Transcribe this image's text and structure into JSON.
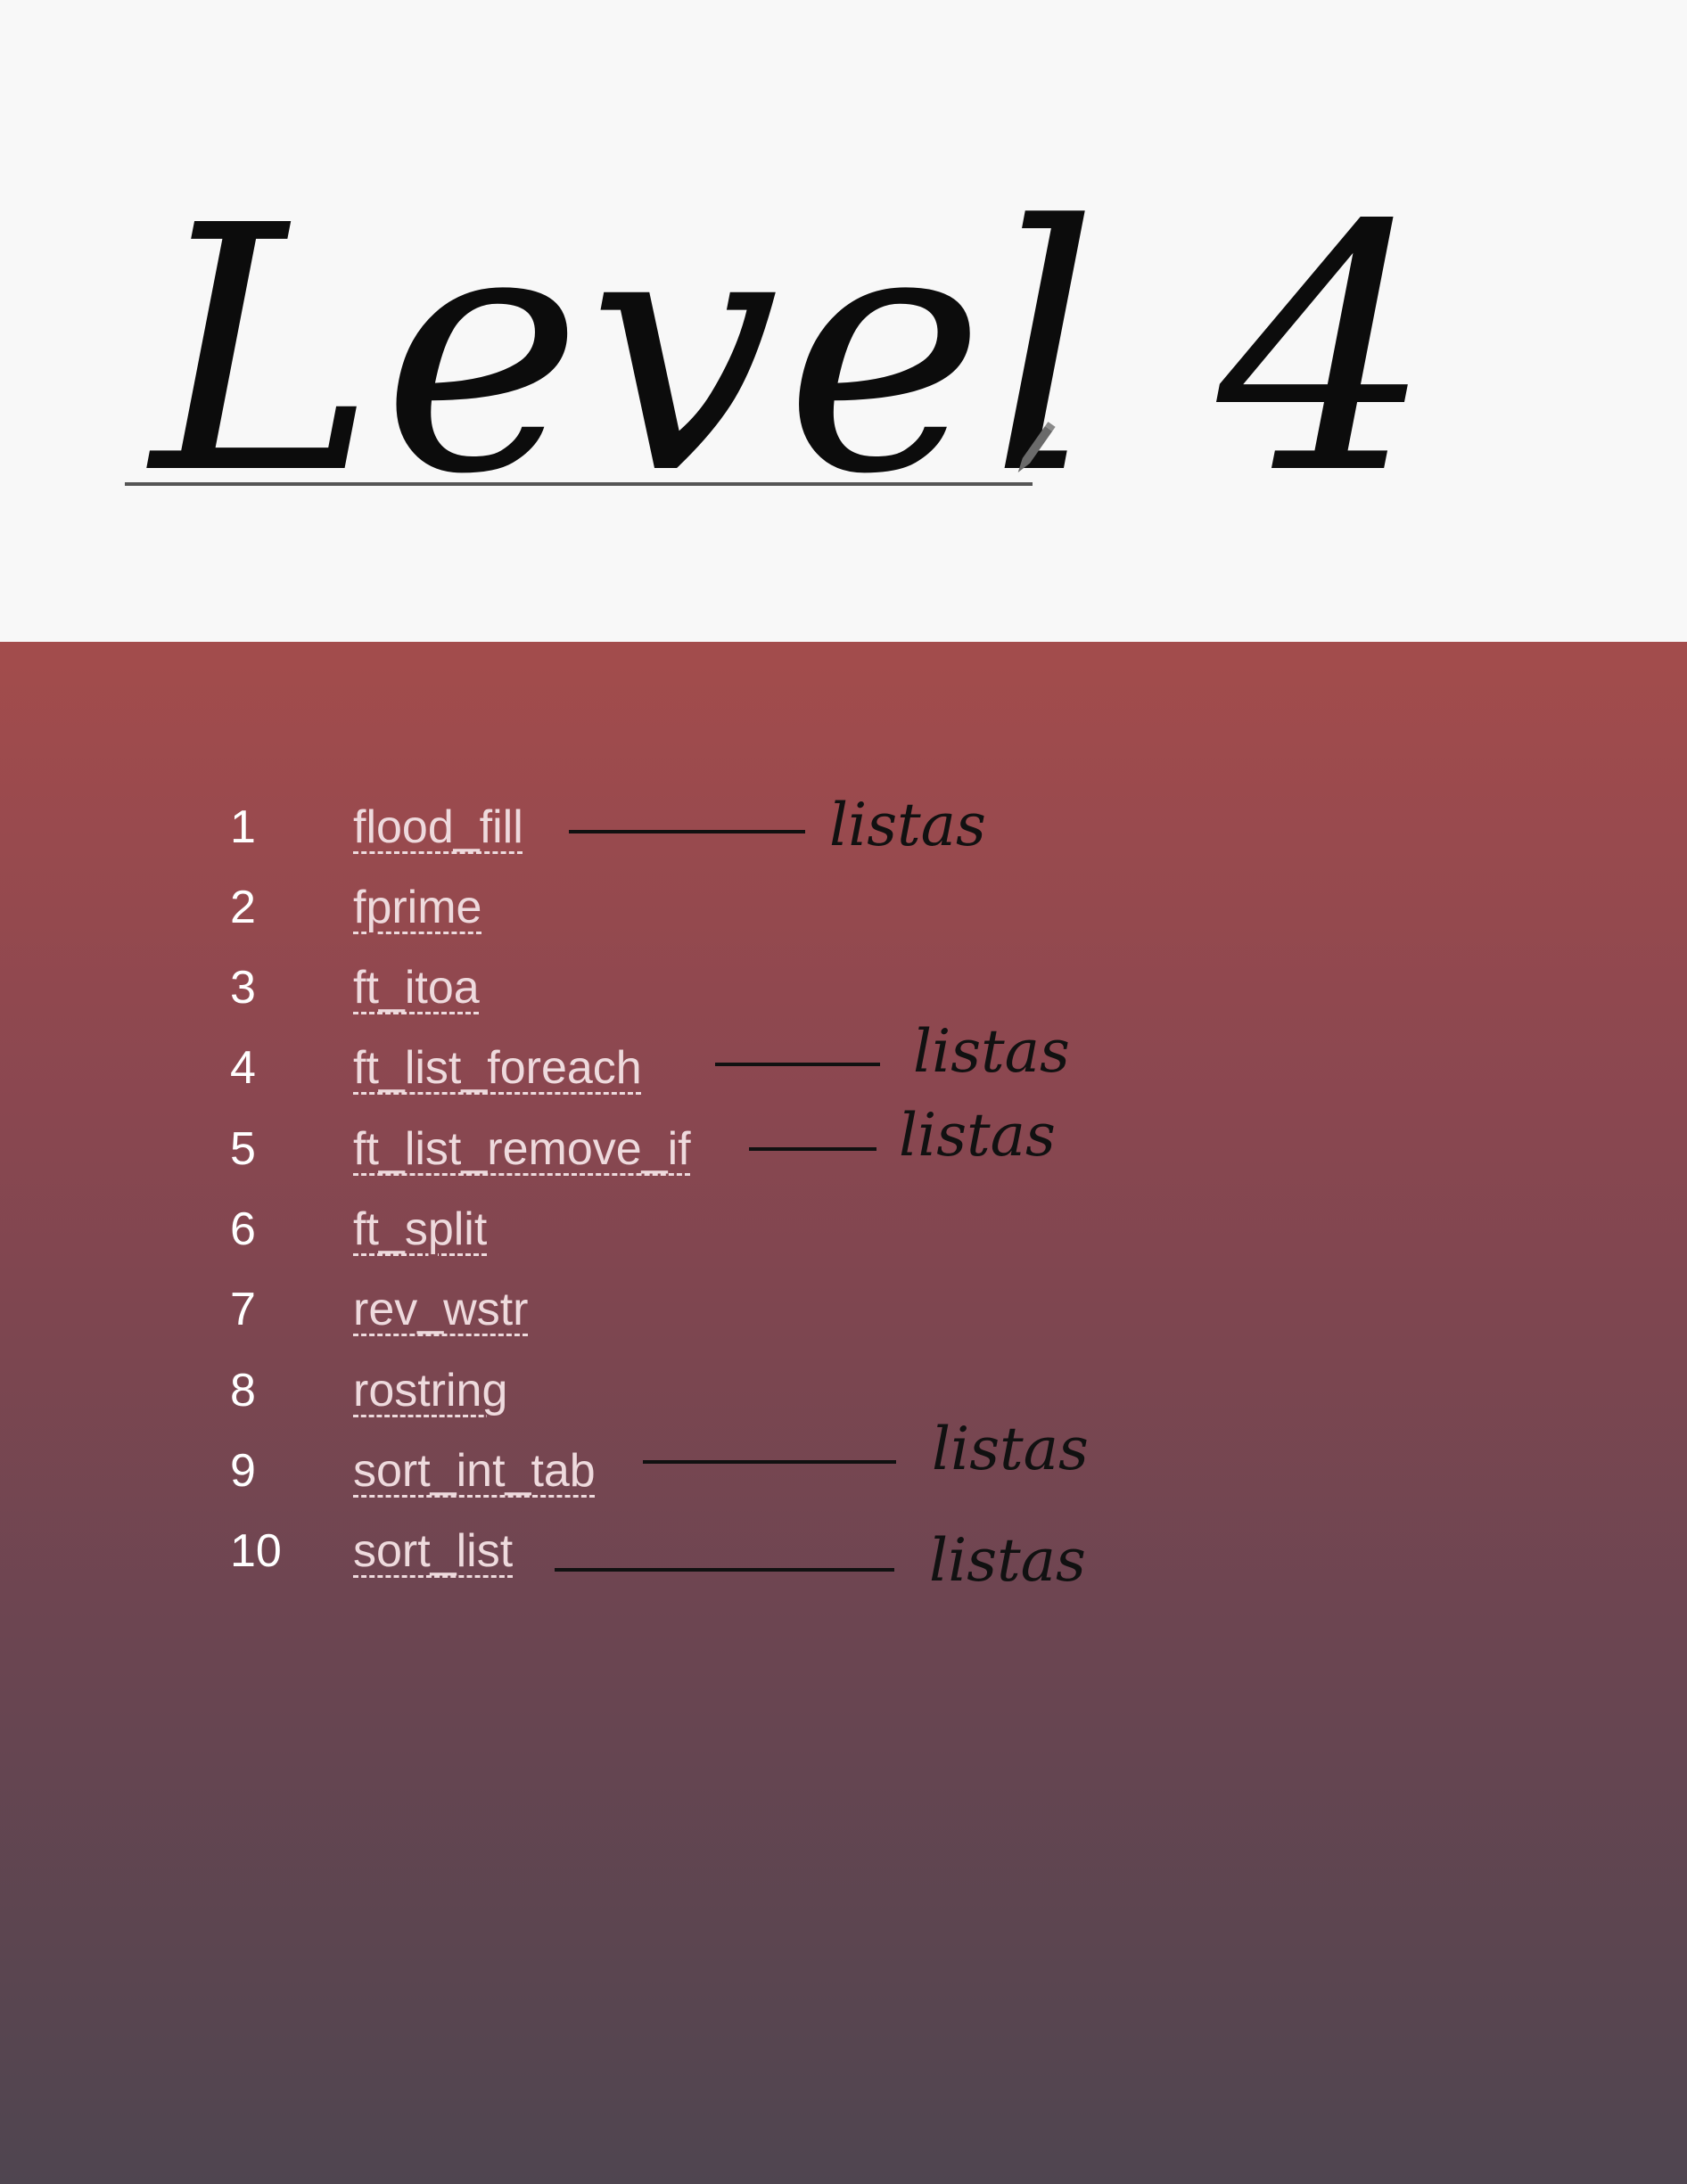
{
  "page": {
    "title": "Level 4"
  },
  "exercises": [
    {
      "num": "1",
      "name": "flood_fill",
      "note": "listas"
    },
    {
      "num": "2",
      "name": "fprime",
      "note": ""
    },
    {
      "num": "3",
      "name": "ft_itoa",
      "note": ""
    },
    {
      "num": "4",
      "name": "ft_list_foreach",
      "note": "listas"
    },
    {
      "num": "5",
      "name": "ft_list_remove_if",
      "note": "listas"
    },
    {
      "num": "6",
      "name": "ft_split",
      "note": ""
    },
    {
      "num": "7",
      "name": "rev_wstr",
      "note": ""
    },
    {
      "num": "8",
      "name": "rostring",
      "note": ""
    },
    {
      "num": "9",
      "name": "sort_int_tab",
      "note": "listas"
    },
    {
      "num": "10",
      "name": "sort_list",
      "note": "listas"
    }
  ],
  "colors": {
    "header_bg": "#f8f8f8",
    "panel_top": "#a34c4c",
    "panel_bottom": "#4f4550",
    "link_text": "#eedadd",
    "number_text": "#ffffff",
    "ink": "#111111"
  },
  "icons": {
    "pen": "pen-tool-icon"
  }
}
